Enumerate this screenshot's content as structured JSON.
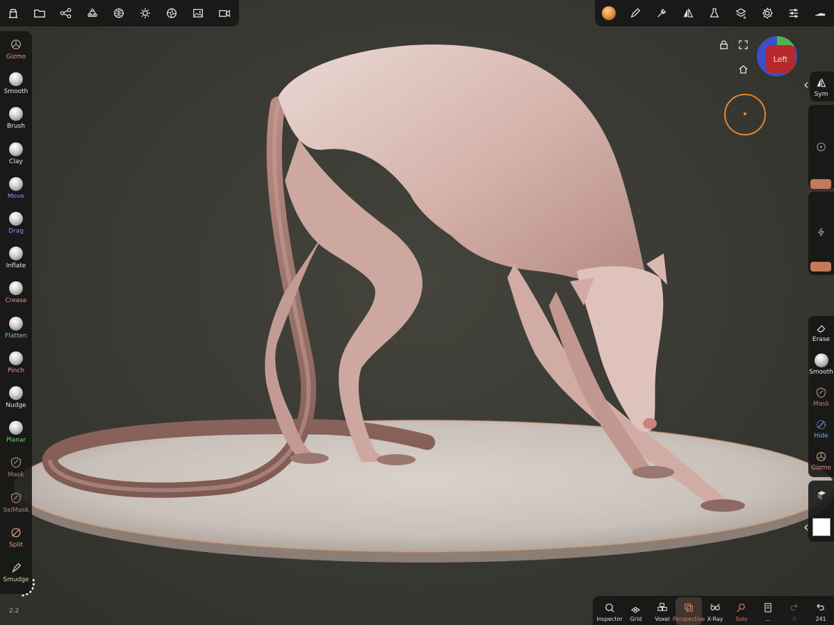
{
  "colors": {
    "accent": "#c47a5a",
    "panel": "#161616",
    "move_label": "#8f8fe8",
    "flatten_label": "#7bd37b",
    "crease_label": "#e89a8a",
    "mask_label": "#b08a70",
    "hide_label": "#7fb0e8",
    "active_label": "#d4845f"
  },
  "top_left_toolbar": [
    {
      "icon": "scene-icon"
    },
    {
      "icon": "folder-icon"
    },
    {
      "icon": "scene-graph-icon"
    },
    {
      "icon": "topology-icon"
    },
    {
      "icon": "sphere-grid-icon"
    },
    {
      "icon": "sun-icon"
    },
    {
      "icon": "aperture-icon"
    },
    {
      "icon": "image-icon"
    },
    {
      "icon": "camera-icon"
    }
  ],
  "top_right_toolbar": [
    {
      "icon": "material-ball-icon"
    },
    {
      "icon": "pen-icon"
    },
    {
      "icon": "dropper-icon"
    },
    {
      "icon": "symmetry-icon"
    },
    {
      "icon": "flask-icon"
    },
    {
      "icon": "layers-icon"
    },
    {
      "icon": "gear-icon"
    },
    {
      "icon": "sliders-icon"
    },
    {
      "icon": "hand-icon"
    }
  ],
  "left_tools": [
    {
      "label": "Gizmo",
      "color": "#e89a8a",
      "type": "gizmo"
    },
    {
      "label": "Smooth",
      "color": "#e8e8e8",
      "type": "ball"
    },
    {
      "label": "Brush",
      "color": "#e8e8e8",
      "type": "ball"
    },
    {
      "label": "Clay",
      "color": "#e8e8e8",
      "type": "ball"
    },
    {
      "label": "Move",
      "color": "#8f8fe8",
      "type": "ball"
    },
    {
      "label": "Drag",
      "color": "#8f8fe8",
      "type": "ball"
    },
    {
      "label": "Inflate",
      "color": "#e8e8e8",
      "type": "ball"
    },
    {
      "label": "Crease",
      "color": "#e89a8a",
      "type": "ball"
    },
    {
      "label": "Flatten",
      "color": "#7bd37b",
      "type": "ball"
    },
    {
      "label": "Pinch",
      "color": "#e89a8a",
      "type": "ball"
    },
    {
      "label": "Nudge",
      "color": "#e8e8e8",
      "type": "ball"
    },
    {
      "label": "Planar",
      "color": "#7bd37b",
      "type": "ball"
    },
    {
      "label": "Mask",
      "color": "#b08a70",
      "type": "shield"
    },
    {
      "label": "SelMask",
      "color": "#b08a70",
      "type": "shield"
    },
    {
      "label": "Split",
      "color": "#e89a8a",
      "type": "split"
    },
    {
      "label": "Smudge",
      "color": "#e8d0a8",
      "type": "smudge"
    }
  ],
  "version": "2.2",
  "viewport": {
    "view_label": "Left"
  },
  "right_tools": {
    "sym": "Sym",
    "erase": "Erase",
    "smooth": "Smooth",
    "mask": "Mask",
    "hide": "Hide",
    "gizmo": "Gizmo"
  },
  "bottom_toolbar": [
    {
      "label": "Inspector",
      "icon": "inspector-icon",
      "active": false
    },
    {
      "label": "Grid",
      "icon": "grid-icon",
      "active": false
    },
    {
      "label": "Voxel",
      "icon": "voxel-icon",
      "active": false
    },
    {
      "label": "Perspective",
      "icon": "perspective-icon",
      "active": true
    },
    {
      "label": "X-Ray",
      "icon": "xray-icon",
      "active": false
    },
    {
      "label": "Solo",
      "icon": "solo-icon",
      "active": true
    },
    {
      "label": "...",
      "icon": "history-icon",
      "active": false
    },
    {
      "label": "0",
      "icon": "redo-icon",
      "active": false
    },
    {
      "label": "241",
      "icon": "undo-icon",
      "active": false
    }
  ]
}
